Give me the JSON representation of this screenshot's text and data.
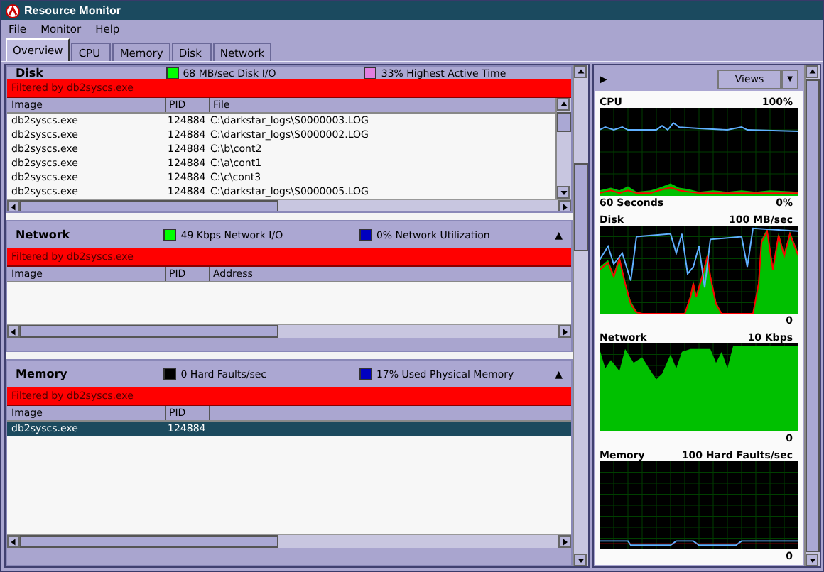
{
  "window": {
    "title": "Resource Monitor"
  },
  "menu": [
    "File",
    "Monitor",
    "Help"
  ],
  "tabs": [
    {
      "label": "Overview",
      "selected": true
    },
    {
      "label": "CPU",
      "selected": false
    },
    {
      "label": "Memory",
      "selected": false
    },
    {
      "label": "Disk",
      "selected": false
    },
    {
      "label": "Network",
      "selected": false
    }
  ],
  "sections": [
    {
      "title": "Disk",
      "metrics": [
        {
          "text": "68 MB/sec Disk I/O",
          "color": "#00ff00"
        },
        {
          "text": "33% Highest Active Time",
          "color": "#e080e0"
        }
      ],
      "filter": "Filtered by db2syscs.exe",
      "columns": [
        "Image",
        "PID",
        "File"
      ],
      "rows": [
        {
          "cells": [
            "db2syscs.exe",
            "124884",
            "C:\\darkstar_logs\\S0000003.LOG"
          ],
          "selected": false
        },
        {
          "cells": [
            "db2syscs.exe",
            "124884",
            "C:\\darkstar_logs\\S0000002.LOG"
          ],
          "selected": false
        },
        {
          "cells": [
            "db2syscs.exe",
            "124884",
            "C:\\b\\cont2"
          ],
          "selected": false
        },
        {
          "cells": [
            "db2syscs.exe",
            "124884",
            "C:\\a\\cont1"
          ],
          "selected": false
        },
        {
          "cells": [
            "db2syscs.exe",
            "124884",
            "C:\\c\\cont3"
          ],
          "selected": false
        },
        {
          "cells": [
            "db2syscs.exe",
            "124884",
            "C:\\darkstar_logs\\S0000005.LOG"
          ],
          "selected": false
        }
      ]
    },
    {
      "title": "Network",
      "expand_glyph": "▲",
      "metrics": [
        {
          "text": "49 Kbps Network I/O",
          "color": "#00ff00"
        },
        {
          "text": "0% Network Utilization",
          "color": "#0000c0"
        }
      ],
      "filter": "Filtered by db2syscs.exe",
      "columns": [
        "Image",
        "PID",
        "Address"
      ]
    },
    {
      "title": "Memory",
      "expand_glyph": "▲",
      "metrics": [
        {
          "text": "0 Hard Faults/sec",
          "color": "#000000"
        },
        {
          "text": "17% Used Physical Memory",
          "color": "#0000c0"
        }
      ],
      "filter": "Filtered by db2syscs.exe",
      "columns": [
        "Image",
        "PID"
      ],
      "rows": [
        {
          "cells": [
            "db2syscs.exe",
            "124884"
          ],
          "selected": true
        }
      ]
    }
  ],
  "side_panel": {
    "expand_glyph": "▶",
    "views_button": "Views",
    "views_caret": "▼"
  },
  "graphs": [
    {
      "kind": "cpu",
      "title": "CPU",
      "max": "100%",
      "time": "60 Seconds",
      "min": "0%"
    },
    {
      "kind": "disk",
      "title": "Disk",
      "max": "100 MB/sec",
      "min": "0"
    },
    {
      "kind": "network",
      "title": "Network",
      "max": "10 Kbps",
      "min": "0"
    },
    {
      "kind": "memory",
      "title": "Memory",
      "max": "100 Hard Faults/sec",
      "min": "0"
    }
  ]
}
